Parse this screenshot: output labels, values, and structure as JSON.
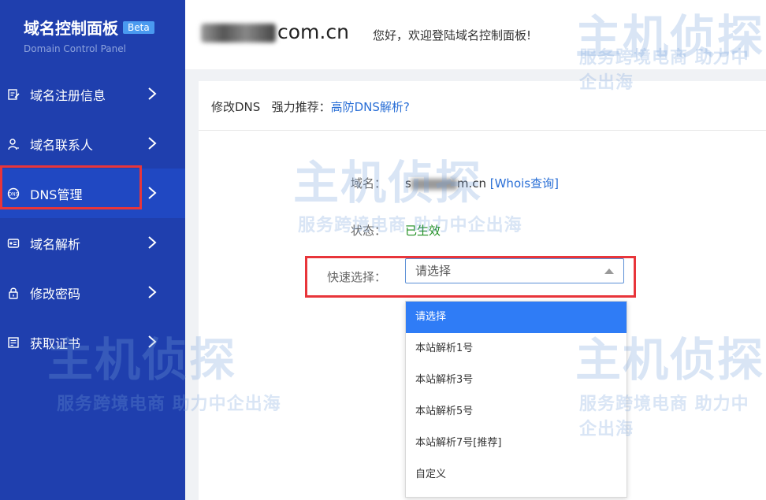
{
  "brand": {
    "title": "域名控制面板",
    "badge": "Beta",
    "subtitle": "Domain Control Panel"
  },
  "header": {
    "domain_suffix": "com.cn",
    "welcome": "您好，欢迎登陆域名控制面板!"
  },
  "sidebar": {
    "items": [
      {
        "label": "域名注册信息",
        "icon": "edit-icon"
      },
      {
        "label": "域名联系人",
        "icon": "user-icon"
      },
      {
        "label": "DNS管理",
        "icon": "dns-icon",
        "active": true
      },
      {
        "label": "域名解析",
        "icon": "resolve-icon"
      },
      {
        "label": "修改密码",
        "icon": "lock-icon"
      },
      {
        "label": "获取证书",
        "icon": "certificate-icon"
      }
    ]
  },
  "panel": {
    "title": "修改DNS",
    "recommend_label": "强力推荐：",
    "recommend_link": "高防DNS解析?",
    "domain_label": "域名：",
    "domain_prefix": "s",
    "domain_suffix": "m.cn",
    "whois_link": "[Whois查询]",
    "status_label": "状态：",
    "status_value": "已生效",
    "quick_select_label": "快速选择：",
    "select_value": "请选择",
    "options": [
      "请选择",
      "本站解析1号",
      "本站解析3号",
      "本站解析5号",
      "本站解析7号[推荐]",
      "自定义"
    ]
  },
  "watermark": {
    "logo": "主机侦探",
    "slogan": "服务跨境电商 助力中企出海"
  },
  "colors": {
    "sidebar": "#1f3fae",
    "active": "#2048c2",
    "highlight": "#e8353a",
    "link": "#2a6fd6",
    "status_ok": "#1e8e1e",
    "option_active": "#2f7cf6"
  }
}
